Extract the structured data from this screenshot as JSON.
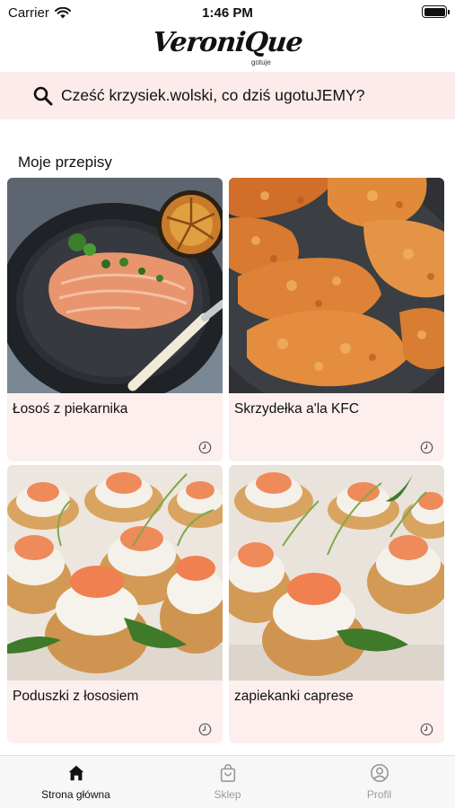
{
  "status_bar": {
    "carrier": "Carrier",
    "time": "1:46 PM"
  },
  "logo": {
    "main": "VeroniQue",
    "sub": "gotuje"
  },
  "search": {
    "text": "Cześć krzysiek.wolski, co dziś ugotuJEMY?"
  },
  "section": {
    "title": "Moje przepisy"
  },
  "recipes": [
    {
      "title": "Łosoś z piekarnika",
      "image": "salmon-image"
    },
    {
      "title": "Skrzydełka a'la KFC",
      "image": "fried-chicken-image"
    },
    {
      "title": "Poduszki z łososiem",
      "image": "salmon-puffs-image"
    },
    {
      "title": "zapiekanki caprese",
      "image": "caprese-puffs-image"
    }
  ],
  "tabs": [
    {
      "label": "Strona główna",
      "icon": "home-icon",
      "active": true
    },
    {
      "label": "Sklep",
      "icon": "shopping-bag-icon",
      "active": false
    },
    {
      "label": "Profil",
      "icon": "profile-icon",
      "active": false
    }
  ],
  "colors": {
    "search_bg": "#fcebea",
    "card_bg": "#fcefee",
    "tab_inactive": "#9a9a9a"
  }
}
